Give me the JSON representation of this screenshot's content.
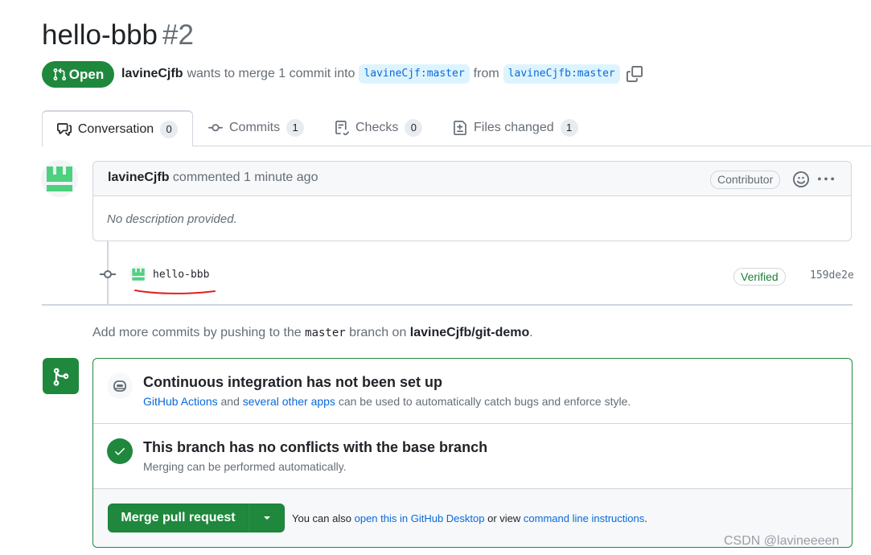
{
  "pr": {
    "title": "hello-bbb",
    "number": "#2",
    "state": "Open",
    "author": "lavineCjfb",
    "meta_text": "wants to merge 1 commit into",
    "base_branch": "lavineCjf:master",
    "from_text": "from",
    "head_branch": "lavineCjfb:master"
  },
  "tabs": [
    {
      "label": "Conversation",
      "count": "0"
    },
    {
      "label": "Commits",
      "count": "1"
    },
    {
      "label": "Checks",
      "count": "0"
    },
    {
      "label": "Files changed",
      "count": "1"
    }
  ],
  "comment": {
    "author": "lavineCjfb",
    "action": "commented 1 minute ago",
    "role": "Contributor",
    "body": "No description provided."
  },
  "commit": {
    "message": "hello-bbb",
    "verified": "Verified",
    "sha": "159de2e"
  },
  "hint": {
    "prefix": "Add more commits by pushing to the",
    "branch": "master",
    "middle": "branch on",
    "repo": "lavineCjfb/git-demo",
    "suffix": "."
  },
  "ci": {
    "title": "Continuous integration has not been set up",
    "link1": "GitHub Actions",
    "and": "and",
    "link2": "several other apps",
    "rest": "can be used to automatically catch bugs and enforce style."
  },
  "conflicts": {
    "title": "This branch has no conflicts with the base branch",
    "text": "Merging can be performed automatically."
  },
  "merge": {
    "button": "Merge pull request",
    "also": "You can also",
    "link1": "open this in GitHub Desktop",
    "or": "or view",
    "link2": "command line instructions",
    "end": "."
  },
  "watermark": "CSDN @lavineeeen",
  "colors": {
    "accent_green": "#1f883d",
    "link_blue": "#0969da"
  }
}
